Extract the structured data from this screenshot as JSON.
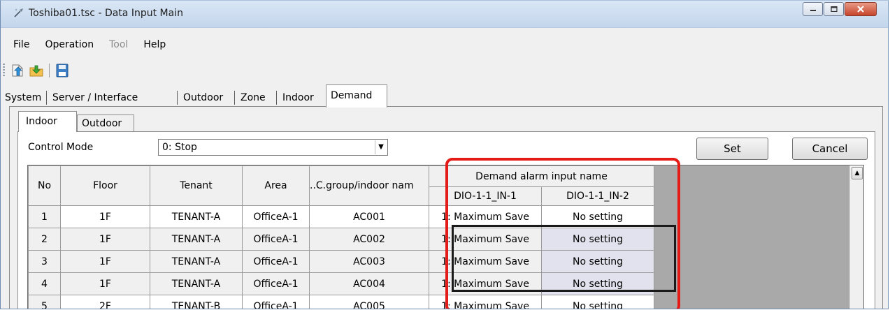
{
  "window": {
    "title": "Toshiba01.tsc - Data Input Main",
    "controls": [
      "minimize",
      "maximize",
      "close"
    ]
  },
  "menu": {
    "items": [
      {
        "label": "File",
        "enabled": true
      },
      {
        "label": "Operation",
        "enabled": true
      },
      {
        "label": "Tool",
        "enabled": false
      },
      {
        "label": "Help",
        "enabled": true
      }
    ]
  },
  "toolbar": {
    "buttons": [
      "export-icon",
      "import-icon",
      "save-icon"
    ]
  },
  "tabs": [
    {
      "label": "System"
    },
    {
      "label": "Server / Interface"
    },
    {
      "label": "Outdoor"
    },
    {
      "label": "Zone"
    },
    {
      "label": "Indoor"
    },
    {
      "label": "Demand",
      "active": true
    }
  ],
  "subtabs": [
    {
      "label": "Indoor",
      "active": true
    },
    {
      "label": "Outdoor"
    }
  ],
  "control_mode": {
    "label": "Control Mode",
    "value": "0: Stop"
  },
  "buttons": {
    "set": "Set",
    "cancel": "Cancel"
  },
  "grid": {
    "group_header": "Demand alarm input name",
    "columns": [
      "No",
      "Floor",
      "Tenant",
      "Area",
      "..C.group/indoor nam",
      "DIO-1-1_IN-1",
      "DIO-1-1_IN-2"
    ],
    "rows": [
      {
        "no": "1",
        "floor": "1F",
        "tenant": "TENANT-A",
        "area": "OfficeA-1",
        "group": "AC001",
        "in1": "1: Maximum Save",
        "in2": "No setting",
        "selected": false
      },
      {
        "no": "2",
        "floor": "1F",
        "tenant": "TENANT-A",
        "area": "OfficeA-1",
        "group": "AC002",
        "in1": "1: Maximum Save",
        "in2": "No setting",
        "selected": true
      },
      {
        "no": "3",
        "floor": "1F",
        "tenant": "TENANT-A",
        "area": "OfficeA-1",
        "group": "AC003",
        "in1": "1: Maximum Save",
        "in2": "No setting",
        "selected": true
      },
      {
        "no": "4",
        "floor": "1F",
        "tenant": "TENANT-A",
        "area": "OfficeA-1",
        "group": "AC004",
        "in1": "1: Maximum Save",
        "in2": "No setting",
        "selected": true
      },
      {
        "no": "5",
        "floor": "2F",
        "tenant": "TENANT-B",
        "area": "OfficeA-1",
        "group": "AC005",
        "in1": "1: Maximum Save",
        "in2": "No setting",
        "selected": false
      }
    ]
  },
  "colors": {
    "highlight_outer": "#e41b17",
    "highlight_inner": "#1a1a1a",
    "grid_background": "#a9a9a9"
  }
}
